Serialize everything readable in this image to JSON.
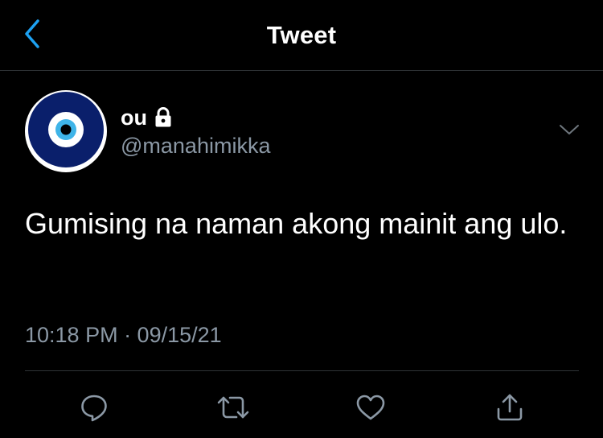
{
  "header": {
    "title": "Tweet",
    "back_icon": "chevron-left-icon",
    "accent_color": "#1da1f2"
  },
  "tweet": {
    "author": {
      "display_name": "ou",
      "username": "@manahimikka",
      "protected_icon": "lock-icon",
      "avatar_icon": "evil-eye-icon"
    },
    "menu_icon": "chevron-down-icon",
    "text": "Gumising na naman akong mainit ang ulo.",
    "timestamp": "10:18 PM · 09/15/21"
  },
  "actions": [
    {
      "icon": "reply-icon"
    },
    {
      "icon": "retweet-icon"
    },
    {
      "icon": "like-icon"
    },
    {
      "icon": "share-icon"
    }
  ],
  "colors": {
    "background": "#000000",
    "text_primary": "#ffffff",
    "text_secondary": "#8b98a5",
    "divider": "#2f3336",
    "avatar_navy": "#0a1f6b",
    "avatar_cyan": "#3fb4e8"
  }
}
